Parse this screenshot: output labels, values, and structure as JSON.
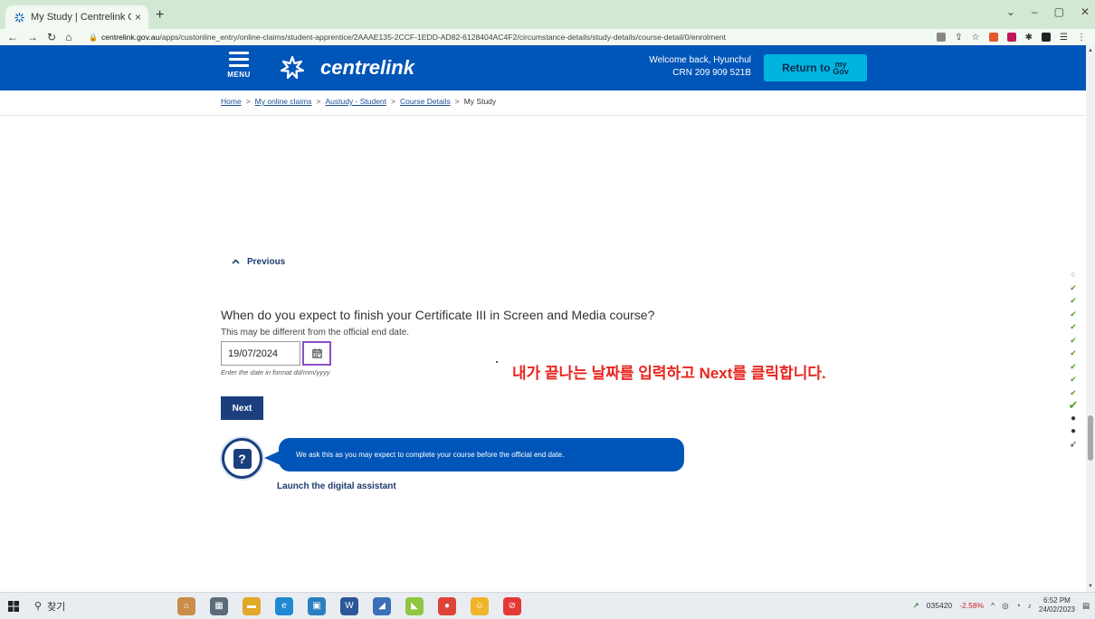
{
  "browser": {
    "tab_title": "My Study | Centrelink Online",
    "tab_close": "×",
    "new_tab": "+",
    "url_host": "centrelink.gov.au",
    "url_path": "/apps/custonline_entry/online-claims/student-apprentice/2AAAE135-2CCF-1EDD-AD82-6128404AC4F2/circumstance-details/study-details/course-detail/0/enrolment",
    "controls": {
      "minimize": "–",
      "maximize": "▢",
      "close": "✕",
      "dropdown": "⌄"
    }
  },
  "header": {
    "menu_label": "MENU",
    "logo_text": "centrelink",
    "welcome_line1": "Welcome back, Hyunchul",
    "welcome_line2": "CRN 209 909 521B",
    "mygov_label": "Return to",
    "mygov_my": "my",
    "mygov_gov": "Gov"
  },
  "breadcrumb": [
    {
      "label": "Home",
      "link": true
    },
    {
      "label": "My online claims",
      "link": true
    },
    {
      "label": "Austudy - Student",
      "link": true
    },
    {
      "label": "Course Details",
      "link": true
    },
    {
      "label": "My Study",
      "link": false
    }
  ],
  "breadcrumb_sep": ">",
  "main": {
    "previous_label": "Previous",
    "question": "When do you expect to finish your Certificate III in Screen and Media course?",
    "hint": "This may be different from the official end date.",
    "date_value": "19/07/2024",
    "format_hint": "Enter the date in format dd/mm/yyyy",
    "next_label": "Next",
    "annotation": "내가 끝나는 날짜를 입력하고 Next를 클릭합니다.",
    "assistant_message": "We ask this as you may expect to complete your course before the official end date.",
    "assistant_link": "Launch the digital assistant",
    "assistant_icon_glyph": "?"
  },
  "progress_markers": [
    "open",
    "done",
    "done",
    "done",
    "done",
    "done",
    "done",
    "done",
    "done",
    "done",
    "current",
    "dot",
    "dot",
    "arrow"
  ],
  "taskbar": {
    "search_label": "찾기",
    "stock_code": "035420",
    "stock_change": "-2.58%",
    "time": "6:52 PM",
    "date": "24/02/2023"
  },
  "colors": {
    "header_blue": "#0055b8",
    "mygov_cyan": "#00b4e0",
    "button_navy": "#1b3f7d",
    "annotation_red": "#e8261f",
    "check_green": "#5aa02c"
  }
}
